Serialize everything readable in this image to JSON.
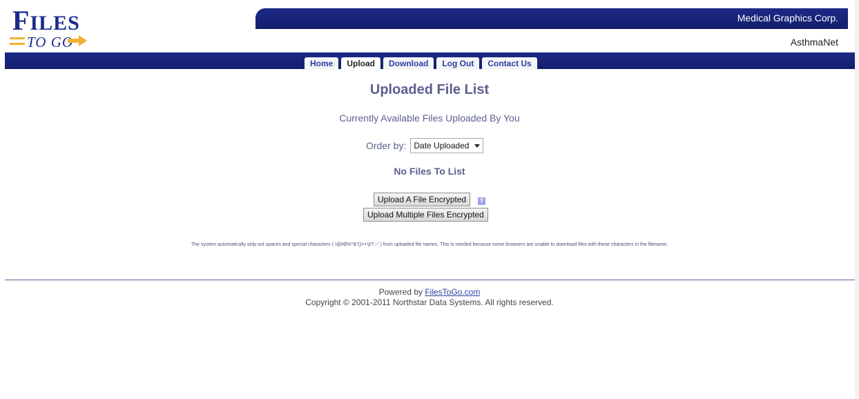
{
  "header": {
    "logo_text_big": "F",
    "logo_text_rest": "ILES",
    "logo_subtext": "TO GO",
    "company": "Medical Graphics Corp.",
    "subname": "AsthmaNet"
  },
  "nav": {
    "tabs": [
      {
        "label": "Home"
      },
      {
        "label": "Upload",
        "active": true
      },
      {
        "label": "Download"
      },
      {
        "label": "Log Out"
      },
      {
        "label": "Contact Us"
      }
    ]
  },
  "main": {
    "title": "Uploaded File List",
    "subtitle": "Currently Available Files Uploaded By You",
    "order_label": "Order by:",
    "order_value": "Date Uploaded",
    "empty_message": "No Files To List",
    "upload_single_label": "Upload A File Encrypted",
    "upload_multi_label": "Upload Multiple Files Encrypted",
    "help_icon": "?",
    "notice": "The system automatically strip out spaces and special characters ( !@#$%^&*()=+\\|/?,~' ) from uploaded file names. This is needed because some browsers are unable to download files with these characters in the filename."
  },
  "footer": {
    "powered_prefix": "Powered by ",
    "powered_link": "FilesToGo.com",
    "copyright": "Copyright © 2001-2011 Northstar Data Systems. All rights reserved."
  },
  "colors": {
    "brand_navy": "#1c2a86",
    "accent_gold": "#f2b233",
    "text_slate": "#5a5f8e"
  }
}
